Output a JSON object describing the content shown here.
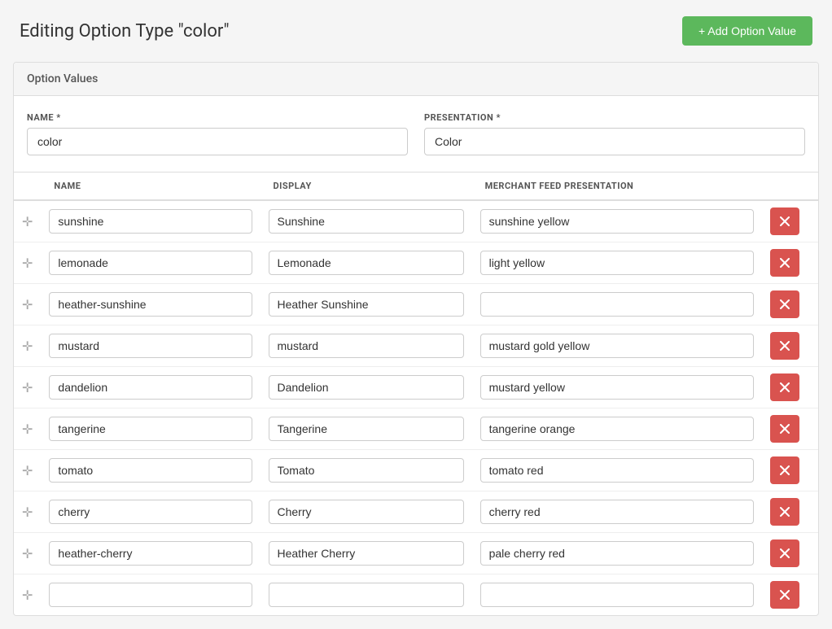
{
  "header": {
    "title": "Editing Option Type \"color\"",
    "add_button_label": "+ Add Option Value"
  },
  "card": {
    "section_title": "Option Values",
    "form": {
      "name_label": "NAME *",
      "name_value": "color",
      "presentation_label": "PRESENTATION *",
      "presentation_value": "Color"
    },
    "table": {
      "columns": [
        "NAME",
        "DISPLAY",
        "MERCHANT FEED PRESENTATION",
        ""
      ],
      "rows": [
        {
          "name": "sunshine",
          "display": "Sunshine",
          "merchant": "sunshine yellow"
        },
        {
          "name": "lemonade",
          "display": "Lemonade",
          "merchant": "light yellow"
        },
        {
          "name": "heather-sunshine",
          "display": "Heather Sunshine",
          "merchant": ""
        },
        {
          "name": "mustard",
          "display": "mustard",
          "merchant": "mustard gold yellow"
        },
        {
          "name": "dandelion",
          "display": "Dandelion",
          "merchant": "mustard yellow"
        },
        {
          "name": "tangerine",
          "display": "Tangerine",
          "merchant": "tangerine orange"
        },
        {
          "name": "tomato",
          "display": "Tomato",
          "merchant": "tomato red"
        },
        {
          "name": "cherry",
          "display": "Cherry",
          "merchant": "cherry red"
        },
        {
          "name": "heather-cherry",
          "display": "Heather Cherry",
          "merchant": "pale cherry red"
        },
        {
          "name": "",
          "display": "",
          "merchant": ""
        }
      ]
    }
  },
  "icons": {
    "drag": "✛",
    "plus": "+",
    "delete": "✕"
  },
  "colors": {
    "add_btn_bg": "#5cb85c",
    "delete_btn_bg": "#d9534f"
  }
}
